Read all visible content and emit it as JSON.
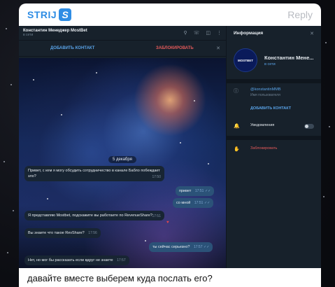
{
  "post": {
    "brand_text": "STRIJ",
    "brand_logo": "S",
    "reply_label": "Reply",
    "caption": "давайте вместе выберем куда послать его?"
  },
  "chat": {
    "title": "Константин Менеджер MostBet",
    "status": "в сети",
    "icons": [
      "search-icon",
      "phone-icon",
      "sidebar-icon",
      "more-icon"
    ],
    "add_contact": "ДОБАВИТЬ КОНТАКТ",
    "block": "ЗАБЛОКИРОВАТЬ",
    "date_chip": "5 декабря",
    "messages": [
      {
        "dir": "in",
        "text": "Привет, с кем я могу обсудить сотрудничество в канале Бабло побеждает зло?",
        "time": "17:50"
      },
      {
        "dir": "out",
        "text": "привет",
        "time": "17:51"
      },
      {
        "dir": "out",
        "text": "со мной",
        "time": "17:51"
      },
      {
        "dir": "in",
        "text": "Я представляю Mostbet, подскажите вы работаете по RevenueShare?",
        "time": "17:51"
      },
      {
        "dir": "in",
        "text": "Вы знаете что такое RevShare?",
        "time": "17:56"
      },
      {
        "dir": "out",
        "text": "ты сейчас серьезно?",
        "time": "17:57"
      },
      {
        "dir": "in",
        "text": "Нет, но мог бы рассказать если вдруг не знаете",
        "time": "17:57"
      }
    ]
  },
  "info": {
    "title": "Информация",
    "name": "Константин Мене...",
    "status": "в сети",
    "avatar_text": "MOSTBET",
    "username": "@konstantinMMB",
    "username_label": "Имя пользователя",
    "add_contact": "ДОБАВИТЬ КОНТАКТ",
    "notifications": "Уведомления",
    "block": "Заблокировать"
  },
  "colors": {
    "accent": "#2f8de4",
    "link": "#59a3e8",
    "danger": "#e45a5a",
    "panel": "#17212b",
    "bubble_in": "#182533",
    "bubble_out": "#2b5278"
  }
}
